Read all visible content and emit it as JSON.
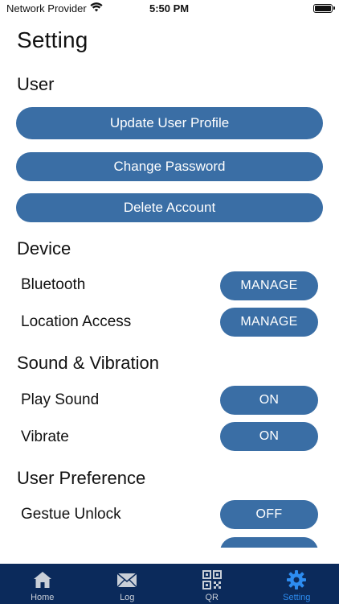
{
  "status_bar": {
    "carrier": "Network Provider",
    "time": "5:50 PM"
  },
  "page": {
    "title": "Setting"
  },
  "sections": {
    "user": {
      "title": "User",
      "buttons": [
        "Update User Profile",
        "Change Password",
        "Delete Account"
      ]
    },
    "device": {
      "title": "Device",
      "rows": [
        {
          "label": "Bluetooth",
          "action": "MANAGE"
        },
        {
          "label": "Location Access",
          "action": "MANAGE"
        }
      ]
    },
    "sound": {
      "title": "Sound & Vibration",
      "rows": [
        {
          "label": "Play Sound",
          "action": "ON"
        },
        {
          "label": "Vibrate",
          "action": "ON"
        }
      ]
    },
    "preference": {
      "title": "User Preference",
      "rows": [
        {
          "label": "Gestue Unlock",
          "action": "OFF"
        }
      ]
    }
  },
  "tab_bar": {
    "tabs": [
      {
        "label": "Home",
        "icon": "home-icon"
      },
      {
        "label": "Log",
        "icon": "mail-icon"
      },
      {
        "label": "QR",
        "icon": "qr-code-icon"
      },
      {
        "label": "Setting",
        "icon": "gear-icon"
      }
    ],
    "active_tab": "Setting"
  },
  "colors": {
    "button": "#3a6ea5",
    "tab_bar": "#0b2a5b",
    "tab_active": "#2d8cf0",
    "tab_inactive": "#c9cfd8"
  }
}
